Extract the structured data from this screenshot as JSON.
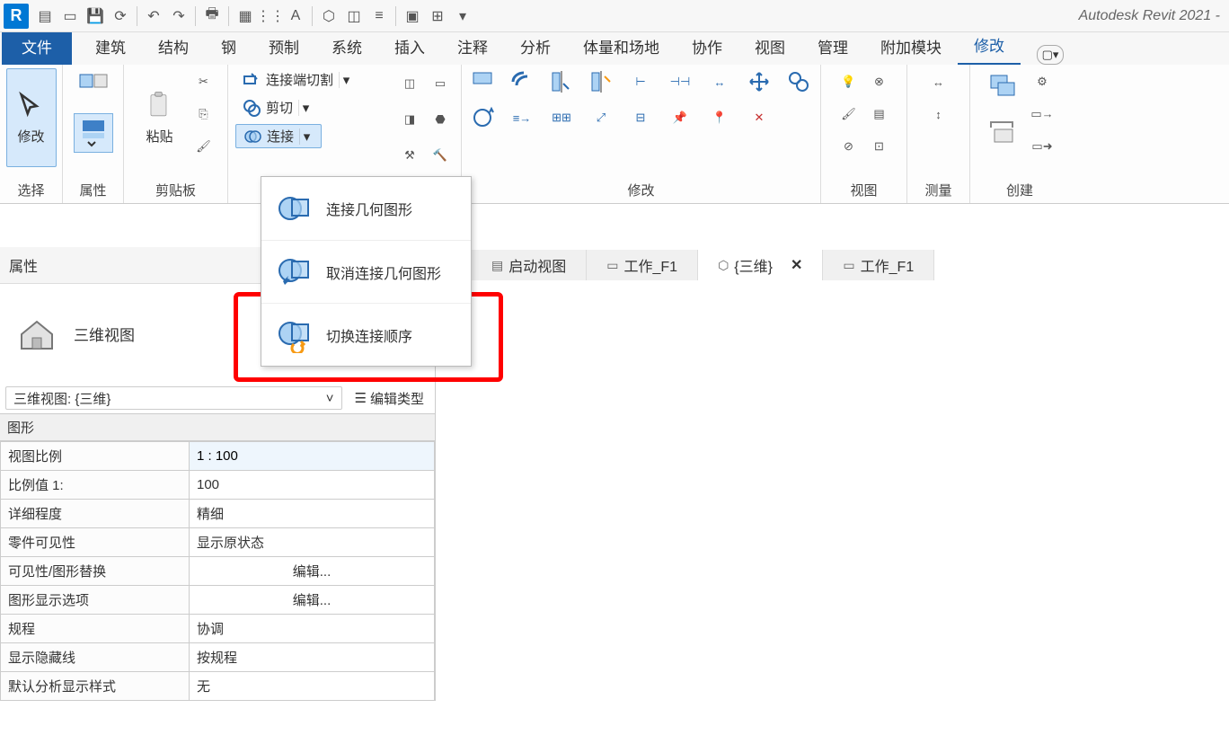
{
  "app": {
    "title": "Autodesk Revit 2021 -"
  },
  "tabs": {
    "file": "文件",
    "items": [
      "建筑",
      "结构",
      "钢",
      "预制",
      "系统",
      "插入",
      "注释",
      "分析",
      "体量和场地",
      "协作",
      "视图",
      "管理",
      "附加模块",
      "修改"
    ],
    "active": "修改"
  },
  "ribbon": {
    "select": {
      "label": "选择",
      "modify": "修改"
    },
    "properties": {
      "label": "属性"
    },
    "clipboard": {
      "label": "剪贴板",
      "paste": "粘贴"
    },
    "geometry": {
      "coping": "连接端切割",
      "cut": "剪切",
      "join": "连接"
    },
    "modify_panel": {
      "label": "修改"
    },
    "view_panel": {
      "label": "视图"
    },
    "measure_panel": {
      "label": "测量"
    },
    "create_panel": {
      "label": "创建"
    }
  },
  "menu": {
    "item1": "连接几何图形",
    "item2": "取消连接几何图形",
    "item3": "切换连接顺序"
  },
  "viewtabs": {
    "t1": "启动视图",
    "t2": "工作_F1",
    "t3": "{三维}",
    "t4": "工作_F1"
  },
  "props": {
    "header": "属性",
    "thumb": "三维视图",
    "type_selected": "三维视图: {三维}",
    "edit_type": "编辑类型",
    "group": "图形",
    "rows": {
      "scale": {
        "k": "视图比例",
        "v": "1 : 100"
      },
      "ratio": {
        "k": "比例值 1:",
        "v": "100"
      },
      "detail": {
        "k": "详细程度",
        "v": "精细"
      },
      "partvis": {
        "k": "零件可见性",
        "v": "显示原状态"
      },
      "visgraph": {
        "k": "可见性/图形替换",
        "v": "编辑..."
      },
      "dispopt": {
        "k": "图形显示选项",
        "v": "编辑..."
      },
      "discipline": {
        "k": "规程",
        "v": "协调"
      },
      "hidden": {
        "k": "显示隐藏线",
        "v": "按规程"
      },
      "analysis": {
        "k": "默认分析显示样式",
        "v": "无"
      }
    }
  }
}
